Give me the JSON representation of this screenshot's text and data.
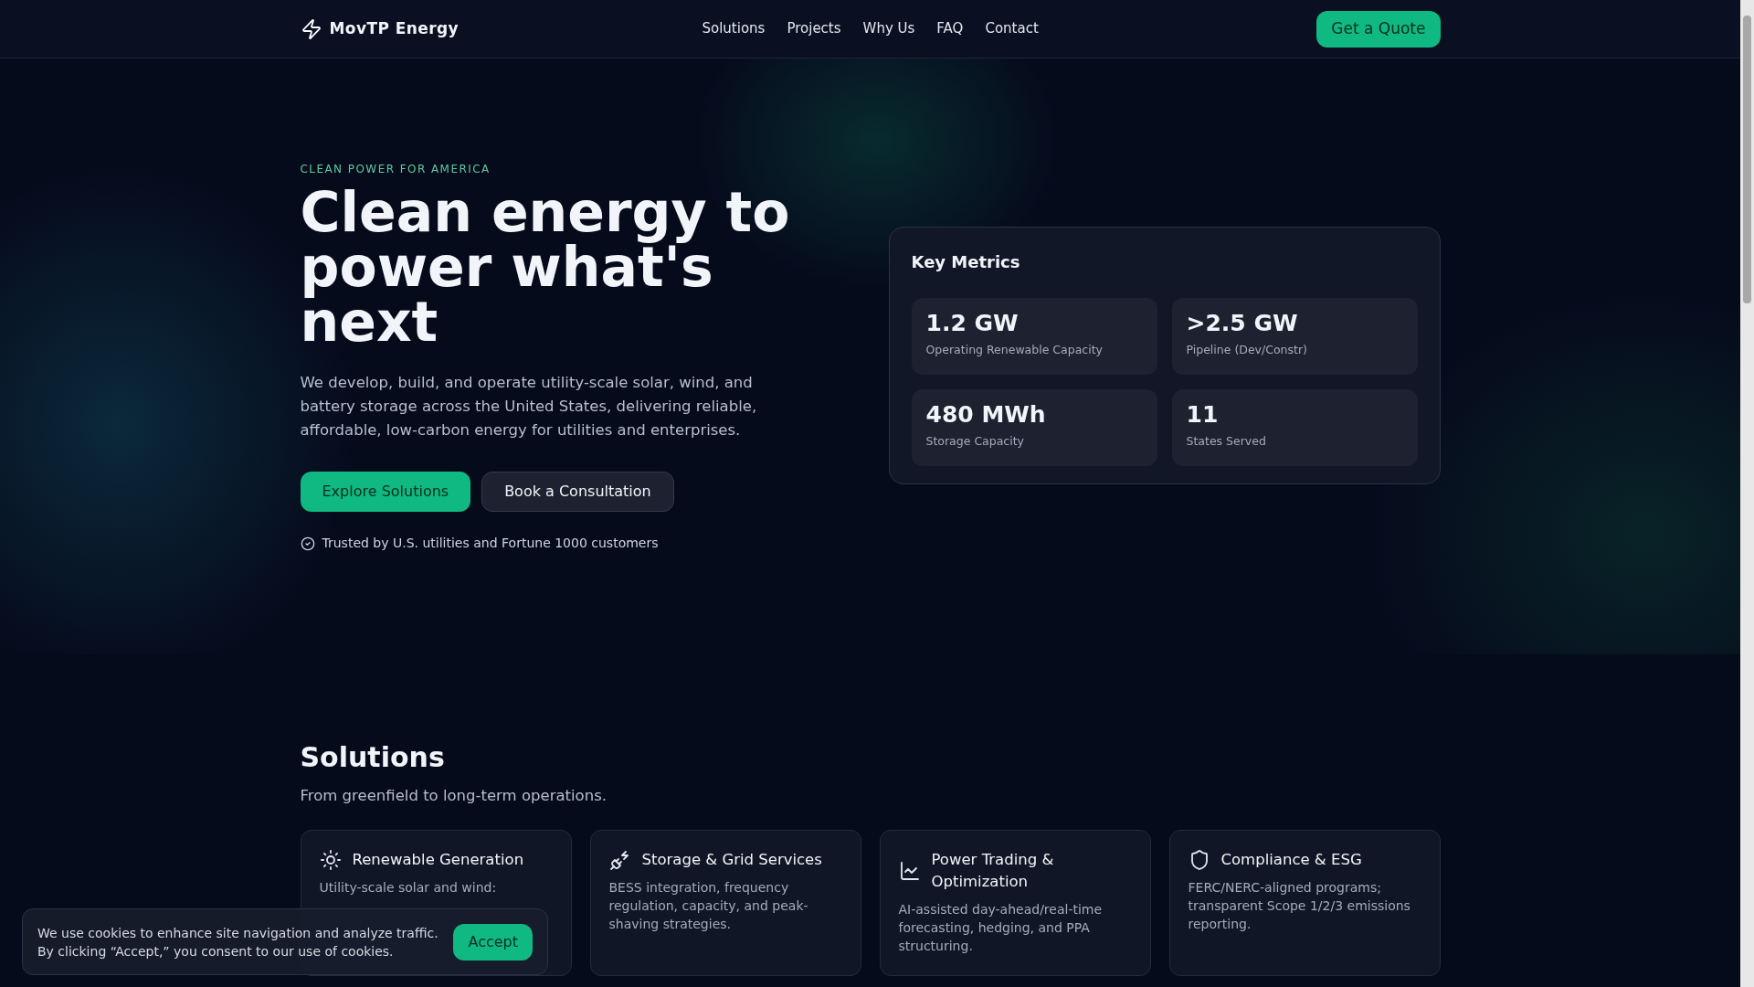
{
  "nav": {
    "brand": "MovTP Energy",
    "links": [
      "Solutions",
      "Projects",
      "Why Us",
      "FAQ",
      "Contact"
    ],
    "cta": "Get a Quote"
  },
  "hero": {
    "eyebrow": "CLEAN POWER FOR AMERICA",
    "heading": "Clean energy to power what's next",
    "body": "We develop, build, and operate utility-scale solar, wind, and battery storage across the United States, delivering reliable, affordable, low-carbon energy for utilities and enterprises.",
    "buttons": [
      {
        "label": "Explore Solutions",
        "kind": "primary"
      },
      {
        "label": "Book a Consultation",
        "kind": "secondary"
      }
    ],
    "trust": "Trusted by U.S. utilities and Fortune 1000 customers"
  },
  "metrics": {
    "title": "Key Metrics",
    "items": [
      {
        "value": "1.2 GW",
        "label": "Operating Renewable Capacity"
      },
      {
        "value": ">2.5 GW",
        "label": "Pipeline (Dev/Constr)"
      },
      {
        "value": "480 MWh",
        "label": "Storage Capacity"
      },
      {
        "value": "11",
        "label": "States Served"
      }
    ]
  },
  "solutions": {
    "title": "Solutions",
    "subtitle": "From greenfield to long-term operations.",
    "cards": [
      {
        "kind": "sun",
        "title": "Renewable Generation",
        "text": "Utility-scale solar and wind:"
      },
      {
        "kind": "plug",
        "title": "Storage & Grid Services",
        "text": "BESS integration, frequency regulation, capacity, and peak-shaving strategies."
      },
      {
        "kind": "chart",
        "title": "Power Trading & Optimization",
        "text": "AI-assisted day-ahead/real-time forecasting, hedging, and PPA structuring."
      },
      {
        "kind": "shield",
        "title": "Compliance & ESG",
        "text": "FERC/NERC-aligned programs; transparent Scope 1/2/3 emissions reporting."
      }
    ]
  },
  "cookie": {
    "text": "We use cookies to enhance site navigation and analyze traffic. By clicking “Accept,” you consent to our use of cookies.",
    "button": "Accept"
  }
}
